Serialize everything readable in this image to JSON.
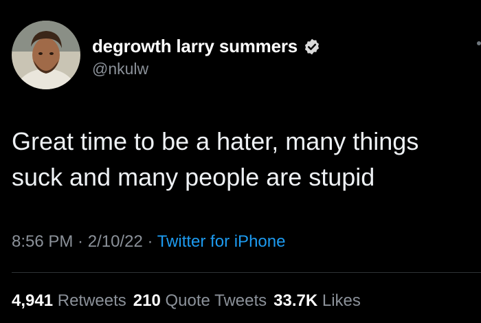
{
  "author": {
    "display_name": "degrowth larry summers",
    "handle": "@nkulw",
    "verified": true
  },
  "tweet": {
    "text_line_1": "Great time to be a hater, many things",
    "text_line_2": "suck and many people are stupid"
  },
  "meta": {
    "time": "8:56 PM",
    "separator_1": " · ",
    "date": "2/10/22",
    "separator_2": " · ",
    "source": "Twitter for iPhone"
  },
  "stats": {
    "retweets_count": "4,941",
    "retweets_label": " Retweets",
    "quotes_count": "210",
    "quotes_label": " Quote Tweets",
    "likes_count": "33.7K",
    "likes_label": " Likes"
  },
  "colors": {
    "background": "#000000",
    "text": "#ffffff",
    "secondary": "#8b9199",
    "link": "#1d9bf0"
  }
}
